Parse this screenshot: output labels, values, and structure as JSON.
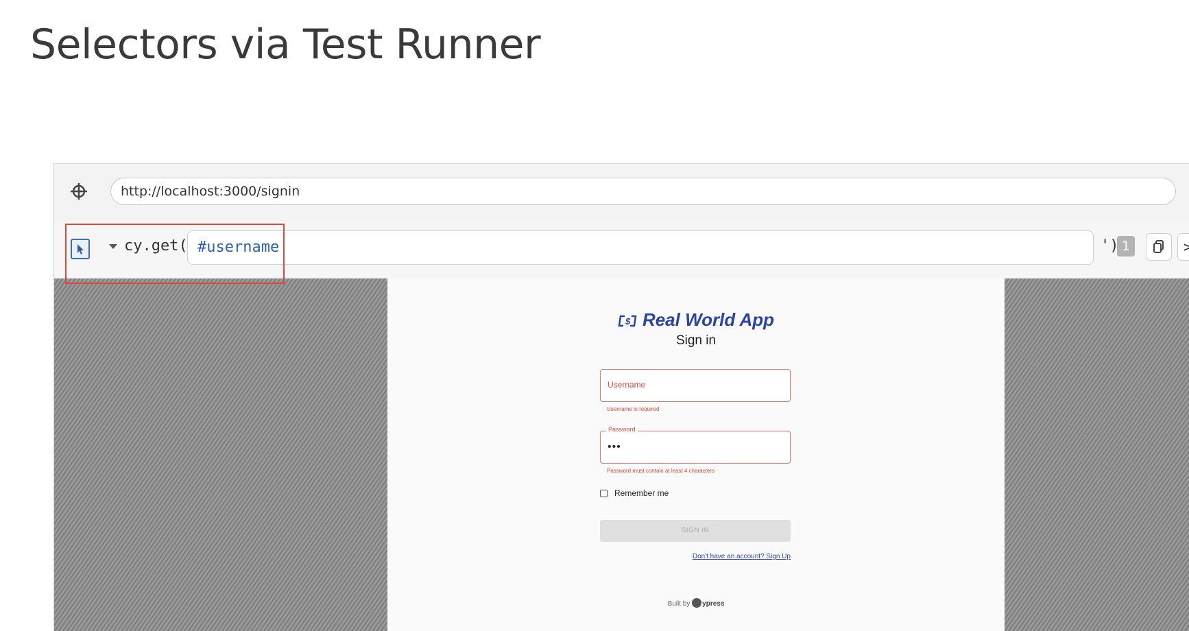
{
  "slide": {
    "title": "Selectors via Test Runner"
  },
  "runner": {
    "url": "http://localhost:3000/signin",
    "selector": {
      "command_prefix": "cy.get('",
      "value": "#username",
      "command_suffix": "')",
      "match_count": "1"
    },
    "icons": {
      "url_icon": "crosshair-icon",
      "playground_icon": "cursor-pointer-icon",
      "copy_icon": "copy-icon",
      "print_icon": "print-to-console-icon"
    },
    "print_label": ">"
  },
  "app": {
    "logo_text": "Real World App",
    "page_title": "Sign in",
    "username": {
      "placeholder": "Username",
      "error": "Username is required"
    },
    "password": {
      "label": "Password",
      "value": "•••",
      "error": "Password must contain at least 4 characters"
    },
    "remember_label": "Remember me",
    "signin_button": "SIGN IN",
    "signup_link": "Don't have an account? Sign Up",
    "footer_prefix": "Built by",
    "footer_brand": "ypress"
  },
  "colors": {
    "accent_blue": "#2c43a6",
    "error_red": "#e0463a",
    "highlight_red": "#e0463a"
  }
}
